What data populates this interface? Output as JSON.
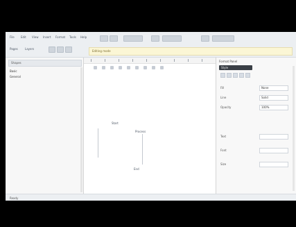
{
  "toolbar": {
    "row1": [
      "File",
      "Edit",
      "View",
      "Insert",
      "Format",
      "Tools",
      "Help"
    ],
    "row2_left": [
      "Pages",
      "Layers"
    ],
    "notice": "Editing mode"
  },
  "left_panel": {
    "title": "Shapes",
    "items": [
      "Basic",
      "General"
    ]
  },
  "canvas": {
    "labels": [
      "Start",
      "Process",
      "End"
    ]
  },
  "properties": {
    "title": "Format Panel",
    "dark_tab": "Style",
    "rows": [
      {
        "key": "Fill",
        "value": "None"
      },
      {
        "key": "Line",
        "value": "Solid"
      },
      {
        "key": "Opacity",
        "value": "100%"
      },
      {
        "key": "Text",
        "value": ""
      },
      {
        "key": "Font",
        "value": ""
      },
      {
        "key": "Size",
        "value": ""
      }
    ]
  },
  "status": {
    "text": "Ready"
  }
}
